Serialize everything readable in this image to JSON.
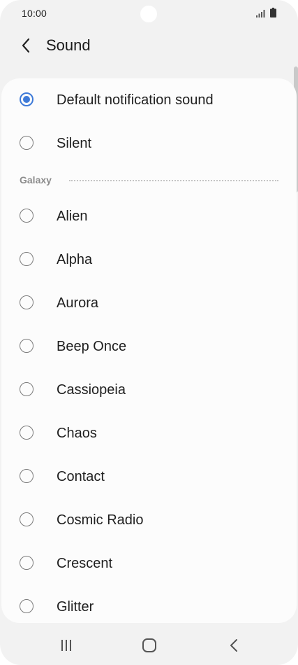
{
  "status_bar": {
    "time": "10:00"
  },
  "header": {
    "title": "Sound"
  },
  "list": {
    "selected_index": 0,
    "top_items": [
      {
        "label": "Default notification sound",
        "selected": true
      },
      {
        "label": "Silent",
        "selected": false
      }
    ],
    "section": {
      "label": "Galaxy"
    },
    "galaxy_items": [
      {
        "label": "Alien",
        "selected": false
      },
      {
        "label": "Alpha",
        "selected": false
      },
      {
        "label": "Aurora",
        "selected": false
      },
      {
        "label": "Beep Once",
        "selected": false
      },
      {
        "label": "Cassiopeia",
        "selected": false
      },
      {
        "label": "Chaos",
        "selected": false
      },
      {
        "label": "Contact",
        "selected": false
      },
      {
        "label": "Cosmic Radio",
        "selected": false
      },
      {
        "label": "Crescent",
        "selected": false
      },
      {
        "label": "Glitter",
        "selected": false
      }
    ]
  },
  "icons": {
    "back": "chevron-left-icon",
    "signal": "signal-icon",
    "battery": "battery-icon",
    "nav_recents": "recents-icon",
    "nav_home": "home-icon",
    "nav_back": "back-icon"
  },
  "colors": {
    "accent": "#3e7ad8",
    "background": "#f2f2f2",
    "card": "#fcfcfc",
    "section_label": "#8c8c8c"
  }
}
